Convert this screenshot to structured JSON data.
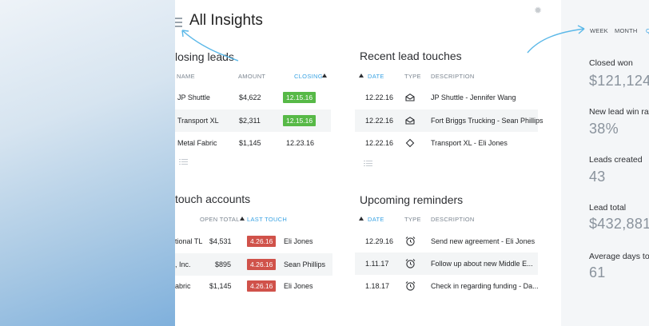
{
  "header": {
    "title": "All Insights"
  },
  "closing_leads": {
    "title": "losing leads",
    "columns": [
      "NAME",
      "AMOUNT",
      "CLOSING"
    ],
    "rows": [
      {
        "name": "JP Shuttle",
        "amount": "$4,622",
        "closing": "12.15.16"
      },
      {
        "name": "Transport XL",
        "amount": "$2,311",
        "closing": "12.15.16"
      },
      {
        "name": "Metal Fabric",
        "amount": "$1,145",
        "closing": "12.23.16"
      }
    ],
    "colors": {
      "badge": "#57b947"
    }
  },
  "touch_accounts": {
    "title": "touch accounts",
    "columns": [
      "OPEN TOTAL",
      "LAST TOUCH"
    ],
    "rows": [
      {
        "name": "tional TL",
        "open_total": "$4,531",
        "last_touch": "4.26.16",
        "contact": "Eli Jones"
      },
      {
        "name": ", Inc.",
        "open_total": "$895",
        "last_touch": "4.26.16",
        "contact": "Sean Phillips"
      },
      {
        "name": "abric",
        "open_total": "$1,145",
        "last_touch": "4.26.16",
        "contact": "Eli Jones"
      }
    ],
    "colors": {
      "badge": "#d0524a"
    }
  },
  "recent_touches": {
    "title": "Recent lead touches",
    "columns": [
      "DATE",
      "TYPE",
      "DESCRIPTION"
    ],
    "rows": [
      {
        "date": "12.22.16",
        "type_icon": "envelope-open-icon",
        "description": "JP Shuttle  - Jennifer Wang"
      },
      {
        "date": "12.22.16",
        "type_icon": "envelope-open-icon",
        "description": "Fort Briggs Trucking - Sean Phillips"
      },
      {
        "date": "12.22.16",
        "type_icon": "tag-icon",
        "description": "Transport XL - Eli Jones"
      }
    ]
  },
  "reminders": {
    "title": "Upcoming reminders",
    "columns": [
      "DATE",
      "TYPE",
      "DESCRIPTION"
    ],
    "rows": [
      {
        "date": "12.29.16",
        "type_icon": "alarm-clock-icon",
        "description": "Send new agreement - Eli Jones"
      },
      {
        "date": "1.11.17",
        "type_icon": "alarm-clock-icon",
        "description": "Follow up about new Middle E..."
      },
      {
        "date": "1.18.17",
        "type_icon": "alarm-clock-icon",
        "description": "Check in regarding funding - Da..."
      }
    ]
  },
  "side": {
    "tabs": [
      "WEEK",
      "MONTH",
      "Q"
    ],
    "active_tab": "Q",
    "metrics": [
      {
        "label": "Closed won",
        "value": "$121,124"
      },
      {
        "label": "New lead win rat",
        "value": "38%"
      },
      {
        "label": "Leads created",
        "value": "43"
      },
      {
        "label": "Lead total",
        "value": "$432,881"
      },
      {
        "label": "Average days to c",
        "value": "61"
      }
    ]
  },
  "colors": {
    "accent": "#3aa3e3",
    "arrow": "#5bb8e8"
  }
}
